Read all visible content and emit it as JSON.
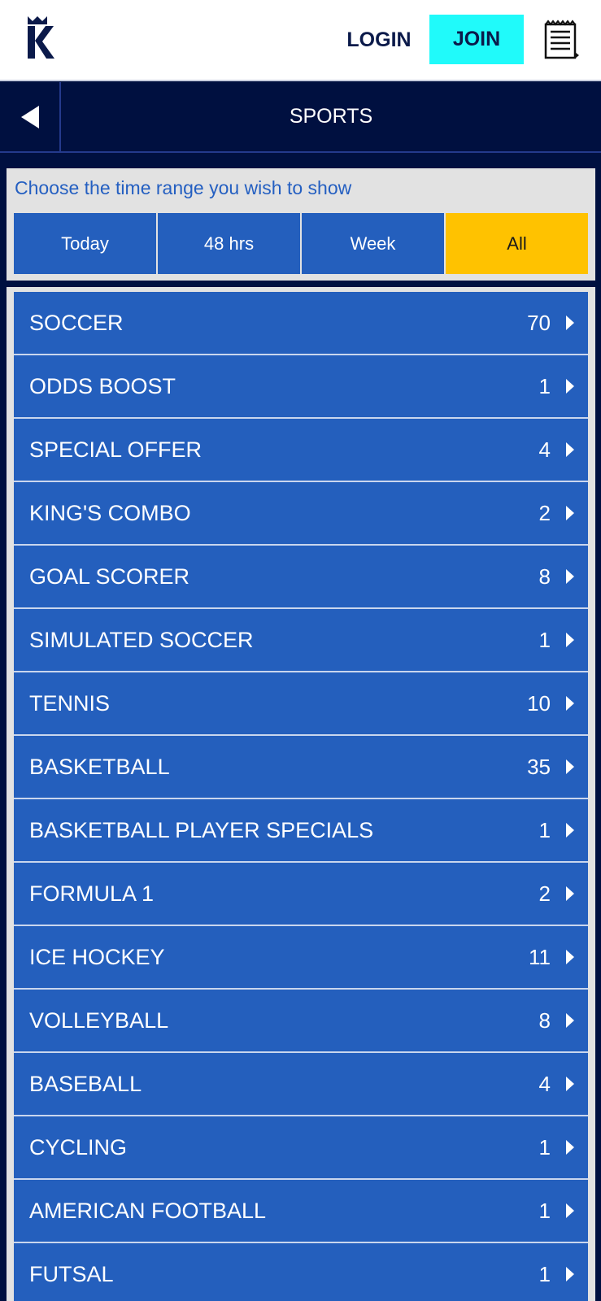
{
  "header": {
    "login_label": "LOGIN",
    "join_label": "JOIN",
    "logo_icon": "k-crown-logo",
    "betslip_icon": "betslip-icon",
    "join_color": "#20fafa"
  },
  "nav": {
    "title": "SPORTS",
    "back_icon": "back-arrow-icon"
  },
  "time_range": {
    "label": "Choose the time range you wish to show",
    "options": [
      "Today",
      "48 hrs",
      "Week",
      "All"
    ],
    "selected": "All",
    "active_color": "#ffc200"
  },
  "sports": [
    {
      "name": "SOCCER",
      "count": "70"
    },
    {
      "name": "ODDS BOOST",
      "count": "1"
    },
    {
      "name": "SPECIAL OFFER",
      "count": "4"
    },
    {
      "name": "KING'S COMBO",
      "count": "2"
    },
    {
      "name": "GOAL SCORER",
      "count": "8"
    },
    {
      "name": "SIMULATED SOCCER",
      "count": "1"
    },
    {
      "name": "TENNIS",
      "count": "10"
    },
    {
      "name": "BASKETBALL",
      "count": "35"
    },
    {
      "name": "BASKETBALL PLAYER SPECIALS",
      "count": "1"
    },
    {
      "name": "FORMULA 1",
      "count": "2"
    },
    {
      "name": "ICE HOCKEY",
      "count": "11"
    },
    {
      "name": "VOLLEYBALL",
      "count": "8"
    },
    {
      "name": "BASEBALL",
      "count": "4"
    },
    {
      "name": "CYCLING",
      "count": "1"
    },
    {
      "name": "AMERICAN FOOTBALL",
      "count": "1"
    },
    {
      "name": "FUTSAL",
      "count": "1"
    }
  ],
  "colors": {
    "navy": "#001040",
    "row_blue": "#245fbd",
    "panel_grey": "#e2e2e2"
  }
}
